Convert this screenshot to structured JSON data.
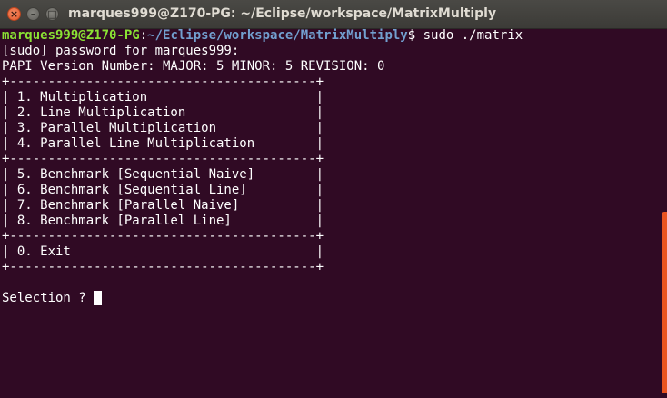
{
  "window": {
    "title": "marques999@Z170-PG: ~/Eclipse/workspace/MatrixMultiply",
    "close_glyph": "×",
    "minimize_glyph": "–",
    "maximize_glyph": "□"
  },
  "prompt": {
    "user_host": "marques999@Z170-PG",
    "separator": ":",
    "path": "~/Eclipse/workspace/MatrixMultiply",
    "symbol": "$",
    "command": " sudo ./matrix"
  },
  "output": [
    "[sudo] password for marques999:",
    "PAPI Version Number: MAJOR: 5 MINOR: 5 REVISION: 0",
    "+----------------------------------------+",
    "| 1. Multiplication                      |",
    "| 2. Line Multiplication                 |",
    "| 3. Parallel Multiplication             |",
    "| 4. Parallel Line Multiplication        |",
    "+----------------------------------------+",
    "| 5. Benchmark [Sequential Naive]        |",
    "| 6. Benchmark [Sequential Line]         |",
    "| 7. Benchmark [Parallel Naive]          |",
    "| 8. Benchmark [Parallel Line]           |",
    "+----------------------------------------+",
    "| 0. Exit                                |",
    "+----------------------------------------+",
    ""
  ],
  "selection_prompt": "Selection ? ",
  "colors": {
    "background": "#300a24",
    "user_host": "#8ae234",
    "path": "#729fcf",
    "text": "#ffffff",
    "scrollbar": "#e95420"
  }
}
